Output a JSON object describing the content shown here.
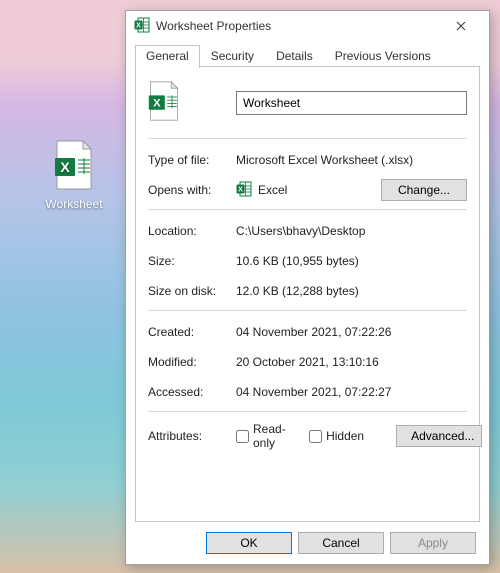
{
  "desktop": {
    "icon_label": "Worksheet"
  },
  "dialog": {
    "title": "Worksheet Properties",
    "tabs": {
      "general": "General",
      "security": "Security",
      "details": "Details",
      "previous": "Previous Versions"
    },
    "filename": "Worksheet",
    "labels": {
      "type_of_file": "Type of file:",
      "opens_with": "Opens with:",
      "location": "Location:",
      "size": "Size:",
      "size_on_disk": "Size on disk:",
      "created": "Created:",
      "modified": "Modified:",
      "accessed": "Accessed:",
      "attributes": "Attributes:"
    },
    "values": {
      "type_of_file": "Microsoft Excel Worksheet (.xlsx)",
      "opens_with_app": "Excel",
      "location": "C:\\Users\\bhavy\\Desktop",
      "size": "10.6 KB (10,955 bytes)",
      "size_on_disk": "12.0 KB (12,288 bytes)",
      "created": "04 November 2021, 07:22:26",
      "modified": "20 October 2021, 13:10:16",
      "accessed": "04 November 2021, 07:22:27"
    },
    "attributes": {
      "read_only_label": "Read-only",
      "read_only_checked": false,
      "hidden_label": "Hidden",
      "hidden_checked": false
    },
    "buttons": {
      "change": "Change...",
      "advanced": "Advanced...",
      "ok": "OK",
      "cancel": "Cancel",
      "apply": "Apply"
    }
  }
}
